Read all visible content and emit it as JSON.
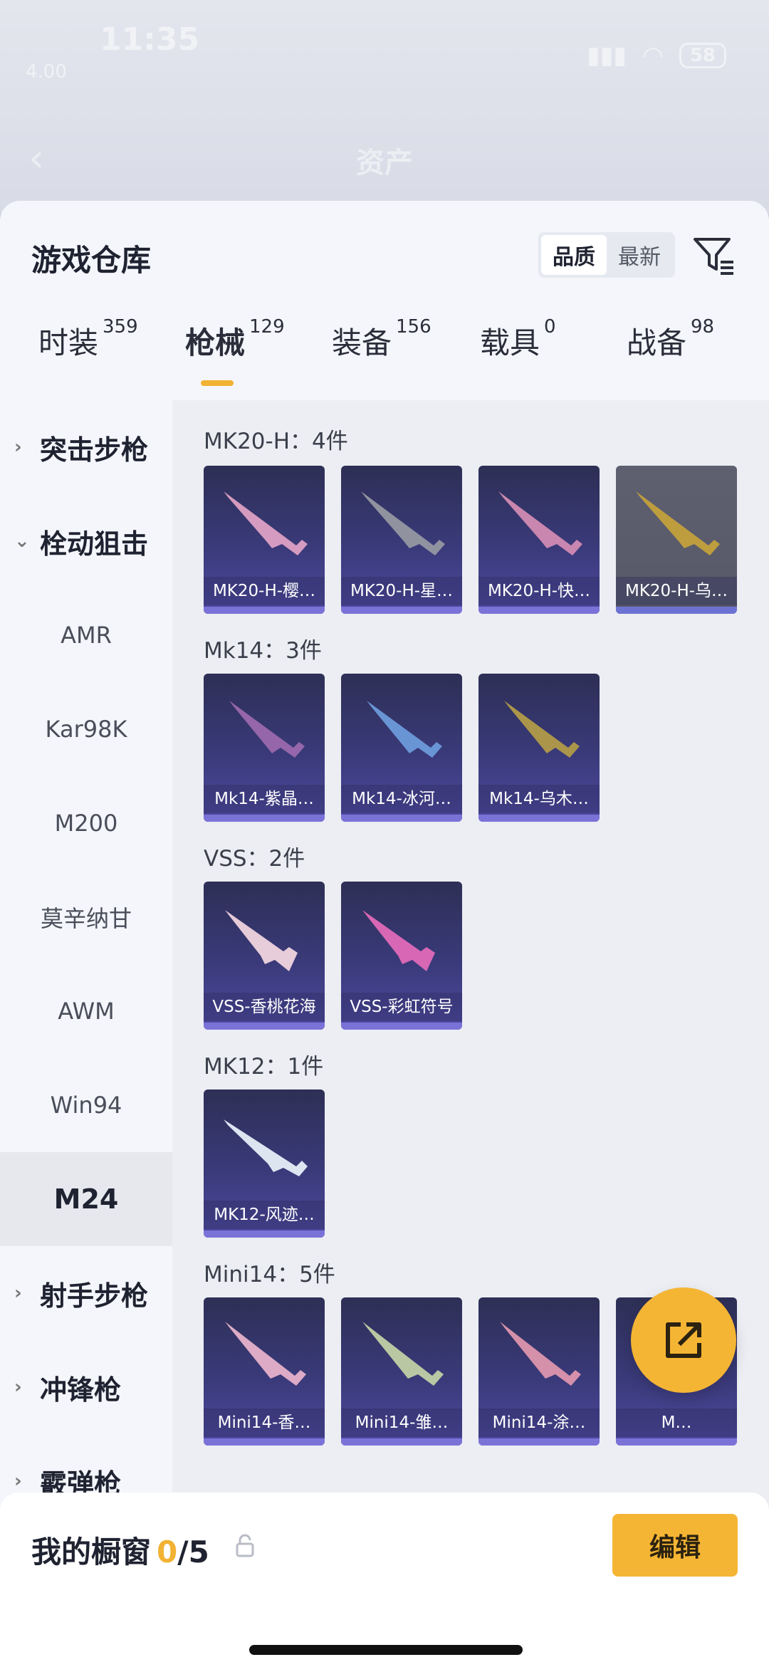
{
  "status": {
    "time": "11:35",
    "speed": "4.00",
    "battery": "58"
  },
  "nav": {
    "back": "‹",
    "title": "资产"
  },
  "sheet": {
    "title": "游戏仓库"
  },
  "sort": {
    "quality": "品质",
    "newest": "最新"
  },
  "tabs": [
    {
      "label": "时装",
      "count": "359"
    },
    {
      "label": "枪械",
      "count": "129"
    },
    {
      "label": "装备",
      "count": "156"
    },
    {
      "label": "载具",
      "count": "0"
    },
    {
      "label": "战备",
      "count": "98"
    }
  ],
  "sidebar": {
    "cat_assault": "突击步枪",
    "cat_bolt": "栓动狙击",
    "amr": "AMR",
    "kar98k": "Kar98K",
    "m200": "M200",
    "mosin": "莫辛纳甘",
    "awm": "AWM",
    "win94": "Win94",
    "m24": "M24",
    "cat_marksman": "射手步枪",
    "cat_smg": "冲锋枪",
    "cat_shotgun": "霰弹枪"
  },
  "groups": [
    {
      "title": "MK20-H：4件",
      "items": [
        "MK20-H-樱…",
        "MK20-H-星…",
        "MK20-H-快…",
        "MK20-H-乌…"
      ]
    },
    {
      "title": "Mk14：3件",
      "items": [
        "Mk14-紫晶…",
        "Mk14-冰河…",
        "Mk14-乌木…"
      ]
    },
    {
      "title": "VSS：2件",
      "items": [
        "VSS-香桃花海",
        "VSS-彩虹符号"
      ]
    },
    {
      "title": "MK12：1件",
      "items": [
        "MK12-风迹…"
      ]
    },
    {
      "title": "Mini14：5件",
      "items": [
        "Mini14-香…",
        "Mini14-雏…",
        "Mini14-涂…",
        "M…"
      ]
    }
  ],
  "colors": {
    "accent": "#f2b233",
    "card_top": "#2d2f55",
    "card_bottom": "#4f4aa0",
    "card_bar": "#7b72d8"
  },
  "showcase": {
    "label": "我的橱窗",
    "current": "0",
    "total": "/5"
  },
  "edit_button": "编辑"
}
